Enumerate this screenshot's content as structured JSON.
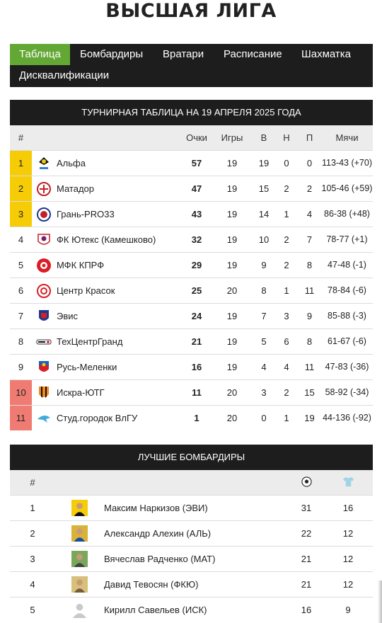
{
  "page_title": "ВЫСШАЯ ЛИГА",
  "tabs": [
    {
      "label": "Таблица",
      "active": true
    },
    {
      "label": "Бомбардиры"
    },
    {
      "label": "Вратари"
    },
    {
      "label": "Расписание"
    },
    {
      "label": "Шахматка"
    },
    {
      "label": "Дисквалификации"
    }
  ],
  "standings": {
    "title": "ТУРНИРНАЯ ТАБЛИЦА НА 19 АПРЕЛЯ 2025 ГОДА",
    "headers": {
      "num": "#",
      "points": "Очки",
      "games": "Игры",
      "w": "В",
      "d": "Н",
      "l": "П",
      "goals": "Мячи"
    },
    "rows": [
      {
        "pos": "1",
        "team": "Альфа",
        "points": "57",
        "games": "19",
        "w": "19",
        "d": "0",
        "l": "0",
        "goals": "113-43 (+70)"
      },
      {
        "pos": "2",
        "team": "Матадор",
        "points": "47",
        "games": "19",
        "w": "15",
        "d": "2",
        "l": "2",
        "goals": "105-46 (+59)"
      },
      {
        "pos": "3",
        "team": "Грань-PRO33",
        "points": "43",
        "games": "19",
        "w": "14",
        "d": "1",
        "l": "4",
        "goals": "86-38 (+48)"
      },
      {
        "pos": "4",
        "team": "ФК Ютекс (Камешково)",
        "points": "32",
        "games": "19",
        "w": "10",
        "d": "2",
        "l": "7",
        "goals": "78-77 (+1)"
      },
      {
        "pos": "5",
        "team": "МФК КПРФ",
        "points": "29",
        "games": "19",
        "w": "9",
        "d": "2",
        "l": "8",
        "goals": "47-48 (-1)"
      },
      {
        "pos": "6",
        "team": "Центр Красок",
        "points": "25",
        "games": "20",
        "w": "8",
        "d": "1",
        "l": "11",
        "goals": "78-84 (-6)"
      },
      {
        "pos": "7",
        "team": "Эвис",
        "points": "24",
        "games": "19",
        "w": "7",
        "d": "3",
        "l": "9",
        "goals": "85-88 (-3)"
      },
      {
        "pos": "8",
        "team": "ТехЦентрГранд",
        "points": "21",
        "games": "19",
        "w": "5",
        "d": "6",
        "l": "8",
        "goals": "61-67 (-6)"
      },
      {
        "pos": "9",
        "team": "Русь-Меленки",
        "points": "16",
        "games": "19",
        "w": "4",
        "d": "4",
        "l": "11",
        "goals": "47-83 (-36)"
      },
      {
        "pos": "10",
        "team": "Искра-ЮТГ",
        "points": "11",
        "games": "20",
        "w": "3",
        "d": "2",
        "l": "15",
        "goals": "58-92 (-34)"
      },
      {
        "pos": "11",
        "team": "Студ.городок ВлГУ",
        "points": "1",
        "games": "20",
        "w": "0",
        "d": "1",
        "l": "19",
        "goals": "44-136 (-92)"
      }
    ]
  },
  "scorers": {
    "title": "ЛУЧШИЕ БОМБАРДИРЫ",
    "headers": {
      "num": "#"
    },
    "rows": [
      {
        "pos": "1",
        "name": "Максим Наркизов (ЭВИ)",
        "goals": "31",
        "games": "16"
      },
      {
        "pos": "2",
        "name": "Александр Алехин (АЛЬ)",
        "goals": "22",
        "games": "12"
      },
      {
        "pos": "3",
        "name": "Вячеслав Радченко (МАТ)",
        "goals": "21",
        "games": "12"
      },
      {
        "pos": "4",
        "name": "Давид Тевосян (ФКЮ)",
        "goals": "21",
        "games": "12"
      },
      {
        "pos": "5",
        "name": "Кирилл Савельев (ИСК)",
        "goals": "16",
        "games": "9"
      }
    ]
  },
  "colors": {
    "accent": "#63a735",
    "header_bg": "#1d1d1d",
    "top3": "#f5cc06",
    "relegation": "#f07b72"
  }
}
